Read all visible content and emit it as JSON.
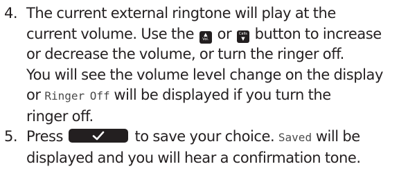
{
  "steps": [
    {
      "number": "4.",
      "line1": "The current external ringtone will play at the",
      "line2_a": "current volume. Use the",
      "line2_b": "or",
      "line2_c": "button to increase",
      "line3": "or decrease the volume, or turn the ringer off.",
      "line4": "You will see the volume level change on the display",
      "line5_a": "or",
      "line5_lcd": "Ringer Off",
      "line5_b": "will be displayed if you turn the",
      "line6": "ringer off.",
      "icon_up_label": "Vol.",
      "icon_down_label": "Calls"
    },
    {
      "number": "5.",
      "line1_a": "Press",
      "line1_b": "to save your choice.",
      "line1_lcd": "Saved",
      "line1_c": "will be",
      "line2": "displayed and you will hear a confirmation tone."
    }
  ],
  "icons": {
    "volume_up": "volume-up-key-icon",
    "volume_down": "volume-down-key-icon",
    "select": "checkmark-softkey-icon"
  },
  "colors": {
    "text": "#231f20",
    "lcd_text": "#4a4a4a",
    "key_fill": "#231f20"
  }
}
